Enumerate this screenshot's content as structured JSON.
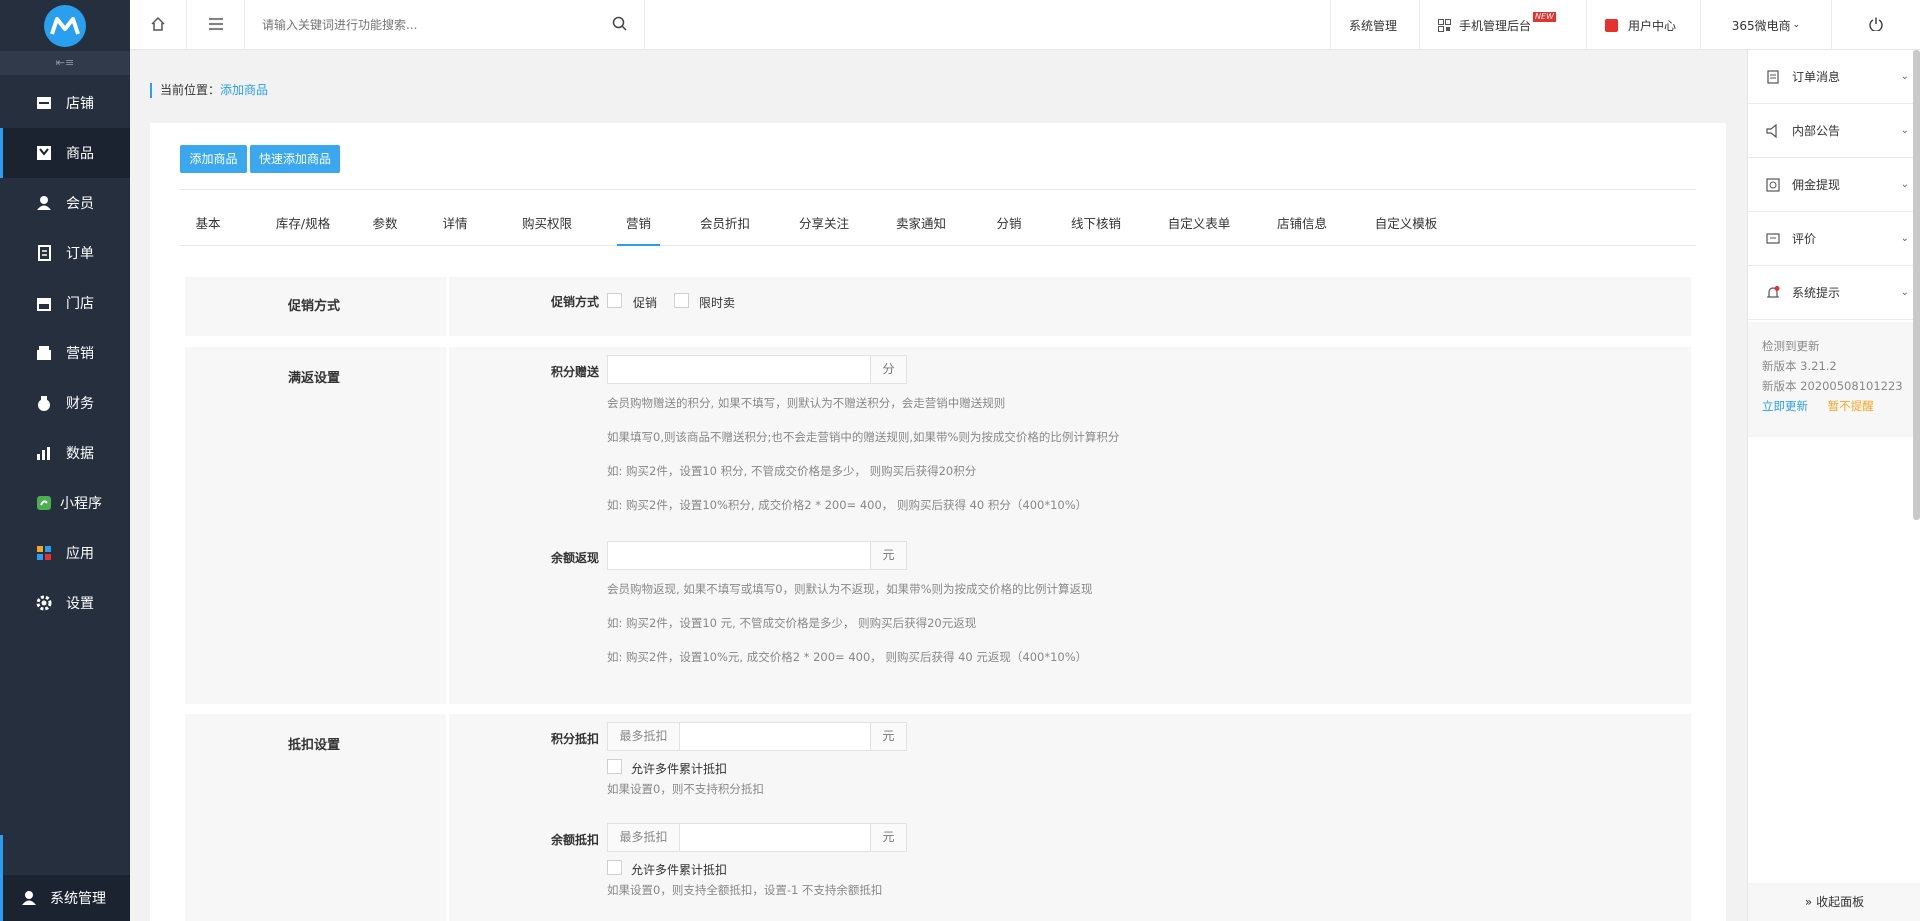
{
  "sidebar": {
    "collapse_label": "⇤≡",
    "items": [
      {
        "label": "店铺",
        "icon": "store-icon"
      },
      {
        "label": "商品",
        "icon": "goods-icon"
      },
      {
        "label": "会员",
        "icon": "member-icon"
      },
      {
        "label": "订单",
        "icon": "order-icon"
      },
      {
        "label": "门店",
        "icon": "shop-icon"
      },
      {
        "label": "营销",
        "icon": "marketing-icon"
      },
      {
        "label": "财务",
        "icon": "finance-icon"
      },
      {
        "label": "数据",
        "icon": "data-icon"
      },
      {
        "label": "小程序",
        "icon": "miniprogram-icon"
      },
      {
        "label": "应用",
        "icon": "apps-icon"
      },
      {
        "label": "设置",
        "icon": "settings-icon"
      }
    ],
    "active_index": 1,
    "bottom_label": "系统管理"
  },
  "topbar": {
    "search_placeholder": "请输入关键词进行功能搜索...",
    "sys_manage": "系统管理",
    "mobile_admin": "手机管理后台",
    "new_badge": "NEW",
    "user_center": "用户中心",
    "account": "365微电商"
  },
  "breadcrumb": {
    "prefix": "当前位置：",
    "current": "添加商品"
  },
  "buttons": {
    "add": "添加商品",
    "quick_add": "快速添加商品"
  },
  "tabs": [
    "基本",
    "库存/规格",
    "参数",
    "详情",
    "购买权限",
    "营销",
    "会员折扣",
    "分享关注",
    "卖家通知",
    "分销",
    "线下核销",
    "自定义表单",
    "店铺信息",
    "自定义模板"
  ],
  "active_tab": 5,
  "promo": {
    "section_title": "促销方式",
    "field_label": "促销方式",
    "opt1": "促销",
    "opt2": "限时卖"
  },
  "rebate": {
    "section_title": "满返设置",
    "points_label": "积分赠送",
    "points_suffix": "分",
    "points_hints": [
      "会员购物赠送的积分, 如果不填写，则默认为不赠送积分，会走营销中赠送规则",
      "如果填写0,则该商品不赠送积分;也不会走营销中的赠送规则,如果带%则为按成交价格的比例计算积分",
      "如: 购买2件，设置10 积分, 不管成交价格是多少， 则购买后获得20积分",
      "如: 购买2件，设置10%积分, 成交价格2 * 200= 400， 则购买后获得 40 积分（400*10%）"
    ],
    "cash_label": "余额返现",
    "cash_suffix": "元",
    "cash_hints": [
      "会员购物返现, 如果不填写或填写0，则默认为不返现，如果带%则为按成交价格的比例计算返现",
      "如: 购买2件，设置10 元, 不管成交价格是多少， 则购买后获得20元返现",
      "如: 购买2件，设置10%元, 成交价格2 * 200= 400， 则购买后获得 40 元返现（400*10%）"
    ]
  },
  "deduct": {
    "section_title": "抵扣设置",
    "points_label": "积分抵扣",
    "prefix": "最多抵扣",
    "suffix": "元",
    "multi_label": "允许多件累计抵扣",
    "points_hint": "如果设置0，则不支持积分抵扣",
    "balance_label": "余额抵扣",
    "balance_hint": "如果设置0，则支持全额抵扣，设置-1 不支持余额抵扣"
  },
  "rightpanel": {
    "items": [
      {
        "label": "订单消息",
        "icon": "order-message-icon"
      },
      {
        "label": "内部公告",
        "icon": "announcement-icon"
      },
      {
        "label": "佣金提现",
        "icon": "commission-icon"
      },
      {
        "label": "评价",
        "icon": "comment-icon"
      },
      {
        "label": "系统提示",
        "icon": "bell-icon"
      }
    ],
    "update": {
      "line1": "检测到更新",
      "line2": "新版本 3.21.2",
      "line3": "新版本 20200508101223",
      "now": "立即更新",
      "later": "暂不提醒"
    },
    "collapse": "» 收起面板"
  },
  "colors": {
    "accent": "#2a9ff0",
    "sidebar_bg": "#262f3e",
    "later": "#f5a623",
    "badge": "#e5322d"
  }
}
